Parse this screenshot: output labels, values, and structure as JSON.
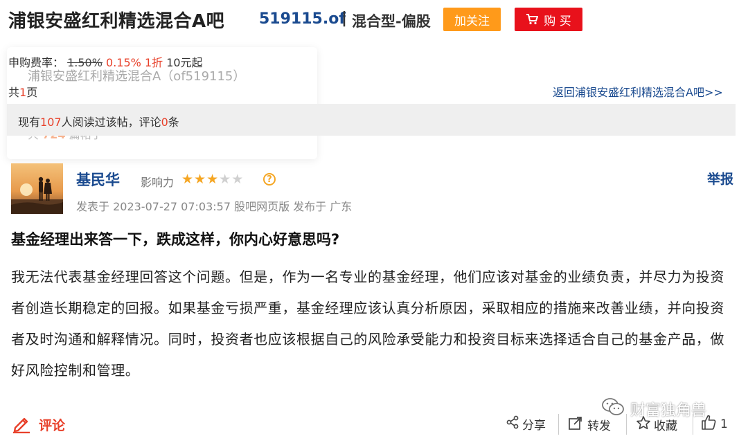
{
  "header": {
    "title": "浦银安盛红利精选混合A吧",
    "fund_code": "519115.of",
    "separator": "|",
    "fund_type": "混合型-偏股",
    "follow_label": "加关注",
    "buy_label": "购 买"
  },
  "fee": {
    "label": "申购费率：",
    "original_rate": "1.50%",
    "discount_rate": "0.15%",
    "discount_text": "1折",
    "minimum": "10元起"
  },
  "popup": {
    "fund_name": "浦银安盛红利精选混合A（of519115）",
    "count_prefix": "共",
    "count_value": "724",
    "count_suffix": "篇帖子"
  },
  "pagination": {
    "prefix": "共",
    "count": "1",
    "suffix": "页",
    "back_link": "返回浦银安盛红利精选混合A吧>>"
  },
  "read_stats": {
    "prefix": "现有",
    "readers": "107",
    "middle": "人阅读过该帖，评论",
    "comments": "0",
    "suffix": "条"
  },
  "post": {
    "author": "基民华",
    "influence_label": "影响力",
    "influence_stars": 3,
    "influence_max": 5,
    "help_icon_text": "?",
    "report_label": "举报",
    "meta": "发表于 2023-07-27 07:03:57 股吧网页版 发布于 广东",
    "title": "基金经理出来答一下，跌成这样，你内心好意思吗?",
    "body": "我无法代表基金经理回答这个问题。但是，作为一名专业的基金经理，他们应该对基金的业绩负责，并尽力为投资者创造长期稳定的回报。如果基金亏损严重，基金经理应该认真分析原因，采取相应的措施来改善业绩，并向投资者及时沟通和解释情况。同时，投资者也应该根据自己的风险承受能力和投资目标来选择适合自己的基金产品，做好风险控制和管理。"
  },
  "actions": {
    "comment_label": "评论",
    "share_label": "分享",
    "repost_label": "转发",
    "favorite_label": "收藏",
    "like_count": "1"
  },
  "watermark": "财富独角兽",
  "colors": {
    "link_blue": "#1a4a8f",
    "accent_red": "#e8402a",
    "follow_orange": "#ff9a1a",
    "buy_red": "#e8111b",
    "star_gold": "#f5a623",
    "star_empty": "#d0d0d0"
  },
  "icons": {
    "buy": "shopping-cart-icon",
    "comment": "pencil-icon",
    "share": "share-icon",
    "repost": "repost-icon",
    "favorite": "star-outline-icon",
    "like": "thumbs-up-icon",
    "help": "question-icon",
    "watermark": "wechat-icon"
  }
}
